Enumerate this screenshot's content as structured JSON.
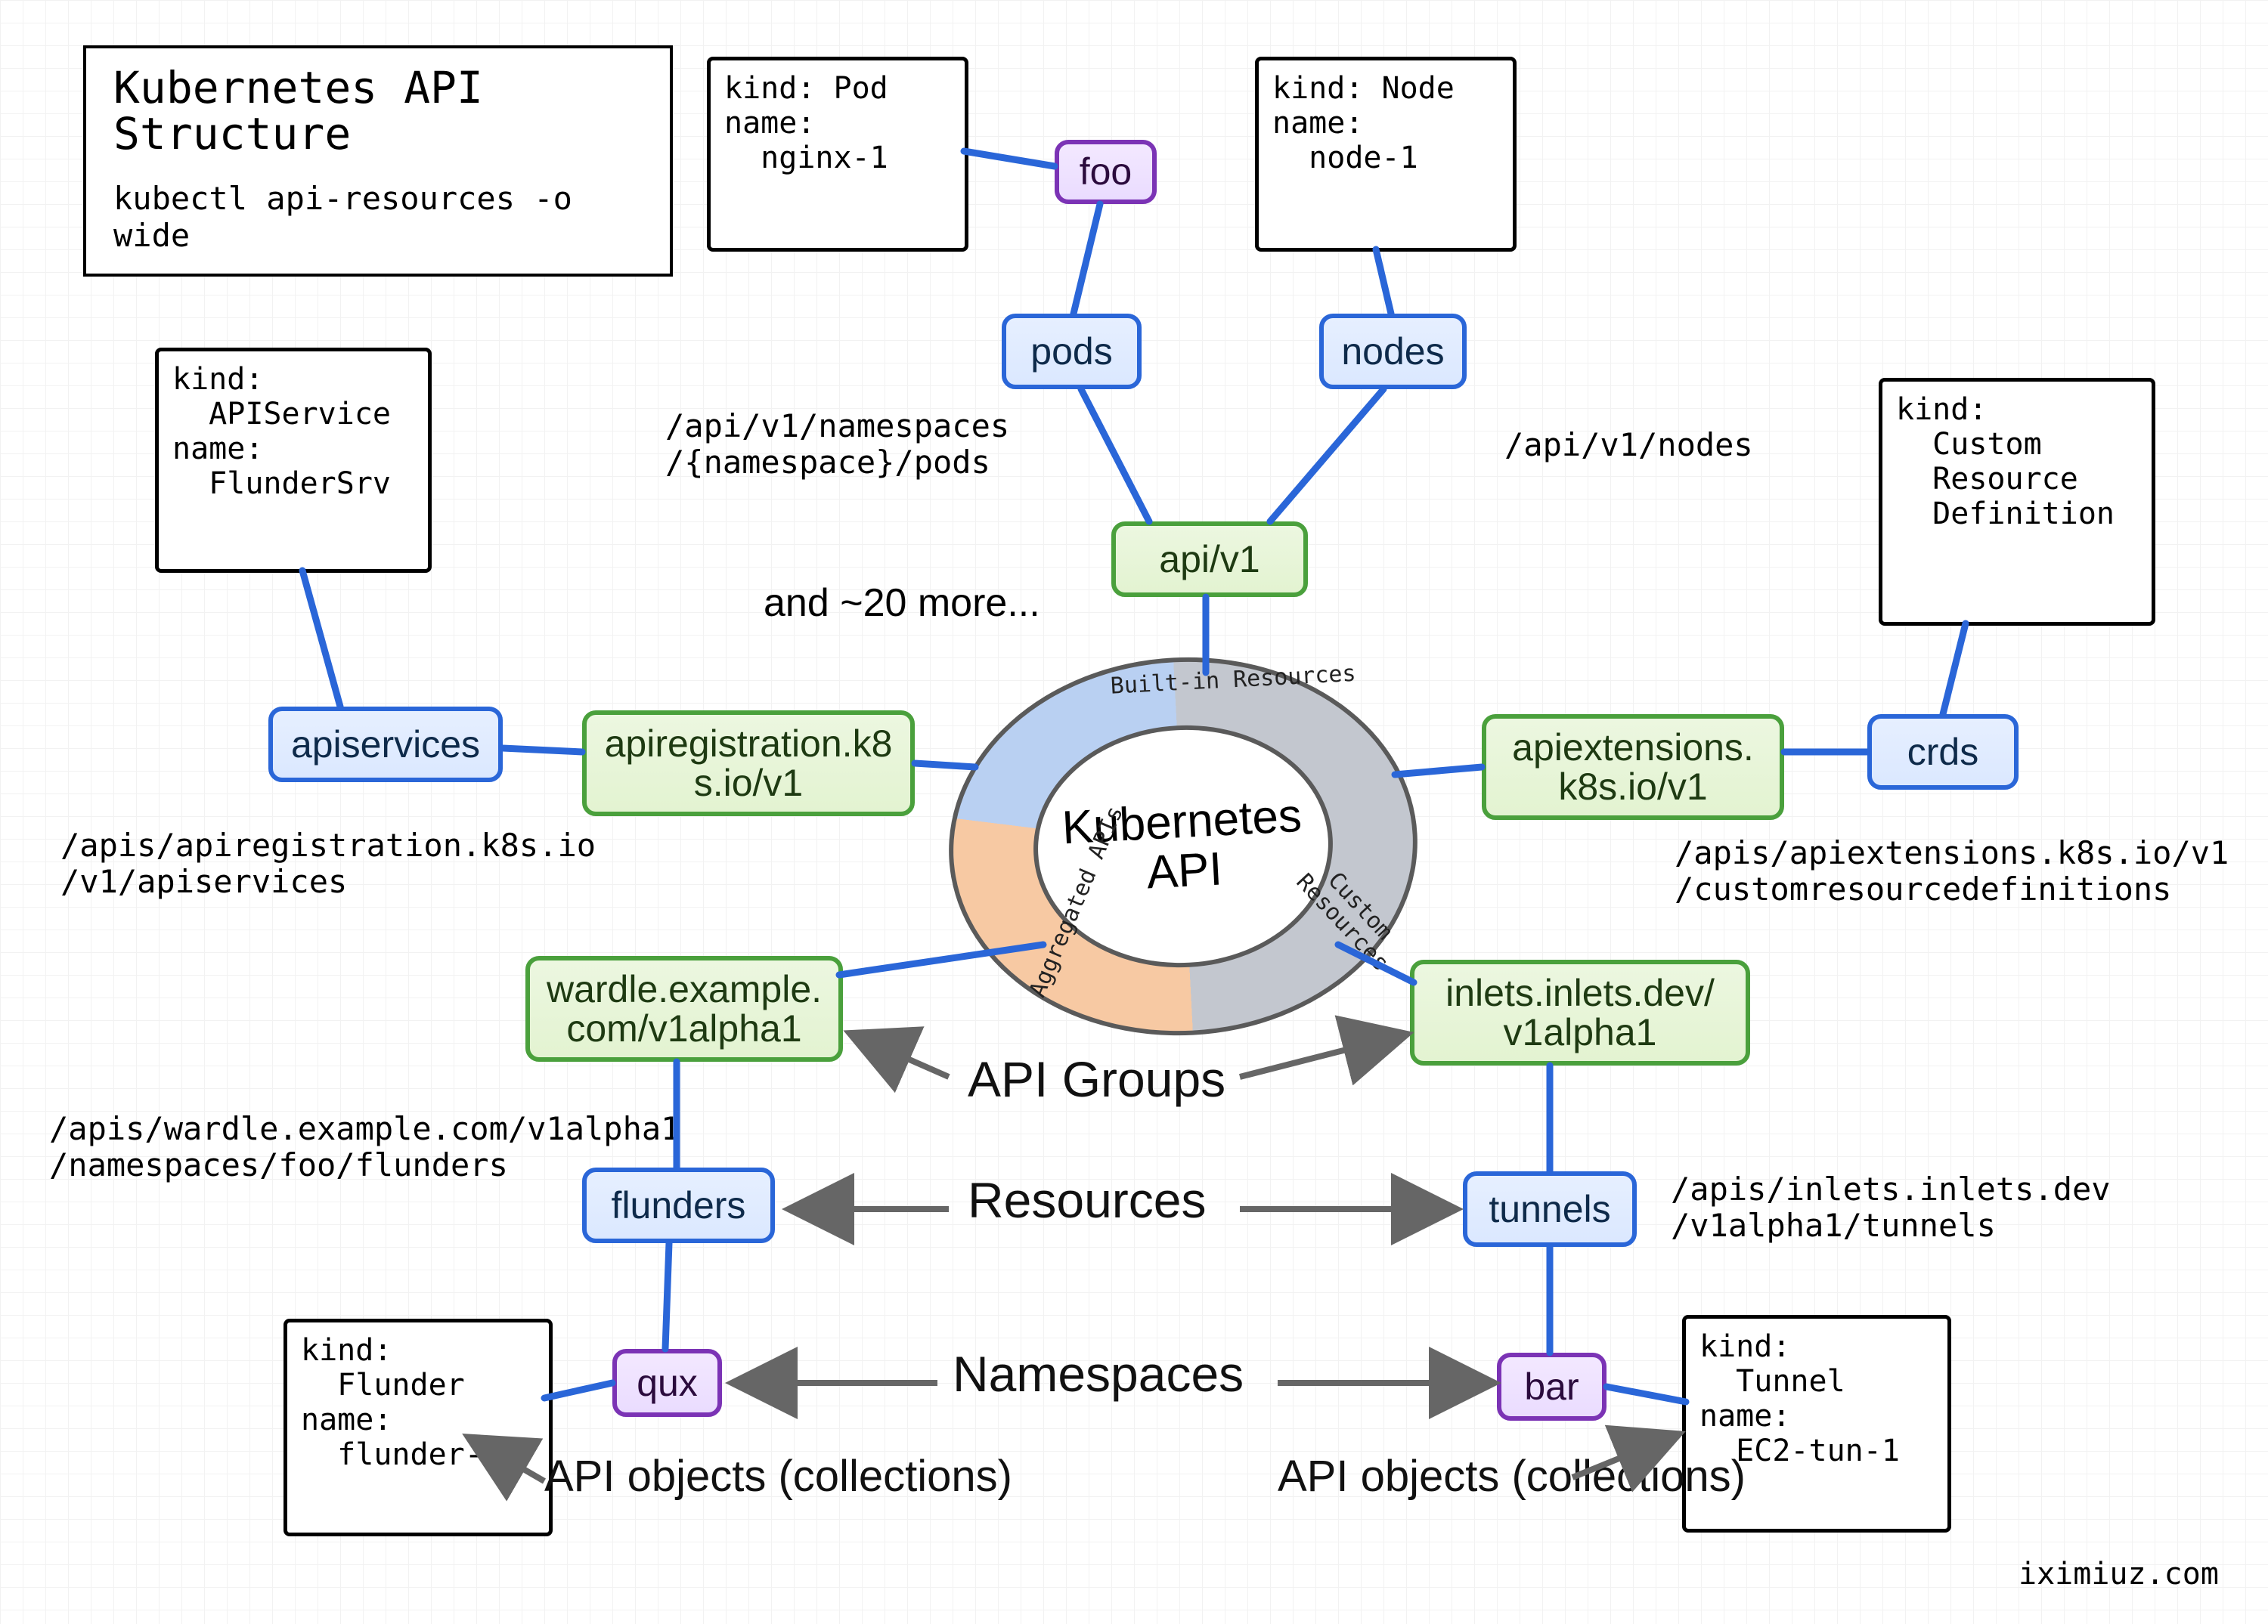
{
  "attribution": "iximiuz.com",
  "title": {
    "heading": "Kubernetes API\nStructure",
    "command": "kubectl api-resources -o wide"
  },
  "donut": {
    "center": "Kubernetes\nAPI",
    "seg_builtin": "Built-in\nResources",
    "seg_custom": "Custom\nResources",
    "seg_aggregated": "Aggregated\nAPIs"
  },
  "boxes": {
    "apiservices": "apiservices",
    "apiregistration": "apiregistration.k8\ns.io/v1",
    "apiv1": "api/v1",
    "pods": "pods",
    "nodes": "nodes",
    "foo": "foo",
    "apiextensions": "apiextensions.\nk8s.io/v1",
    "crds": "crds",
    "wardle": "wardle.example.\ncom/v1alpha1",
    "flunders": "flunders",
    "qux": "qux",
    "inlets": "inlets.inlets.dev/\nv1alpha1",
    "tunnels": "tunnels",
    "bar": "bar"
  },
  "stacks": {
    "apiservice": "kind:\n  APIService\nname:\n  FlunderSrv",
    "pod": "kind: Pod\nname:\n  nginx-1",
    "node": "kind: Node\nname:\n  node-1",
    "crd": "kind:\n  Custom\n  Resource\n  Definition",
    "flunder": "kind:\n  Flunder\nname:\n  flunder-1",
    "tunnel": "kind:\n  Tunnel\nname:\n  EC2-tun-1"
  },
  "paths": {
    "apiservices": "/apis/apiregistration.k8s.io\n/v1/apiservices",
    "pods": "/api/v1/namespaces\n/{namespace}/pods",
    "nodes": "/api/v1/nodes",
    "crds": "/apis/apiextensions.k8s.io/v1\n/customresourcedefinitions",
    "wardle": "/apis/wardle.example.com/v1alpha1\n/namespaces/foo/flunders",
    "inlets": "/apis/inlets.inlets.dev\n/v1alpha1/tunnels",
    "and_more": "and ~20 more..."
  },
  "legends": {
    "api_groups": "API Groups",
    "resources": "Resources",
    "namespaces": "Namespaces",
    "api_objects_left": "API objects\n(collections)",
    "api_objects_right": "API objects\n(collections)"
  }
}
